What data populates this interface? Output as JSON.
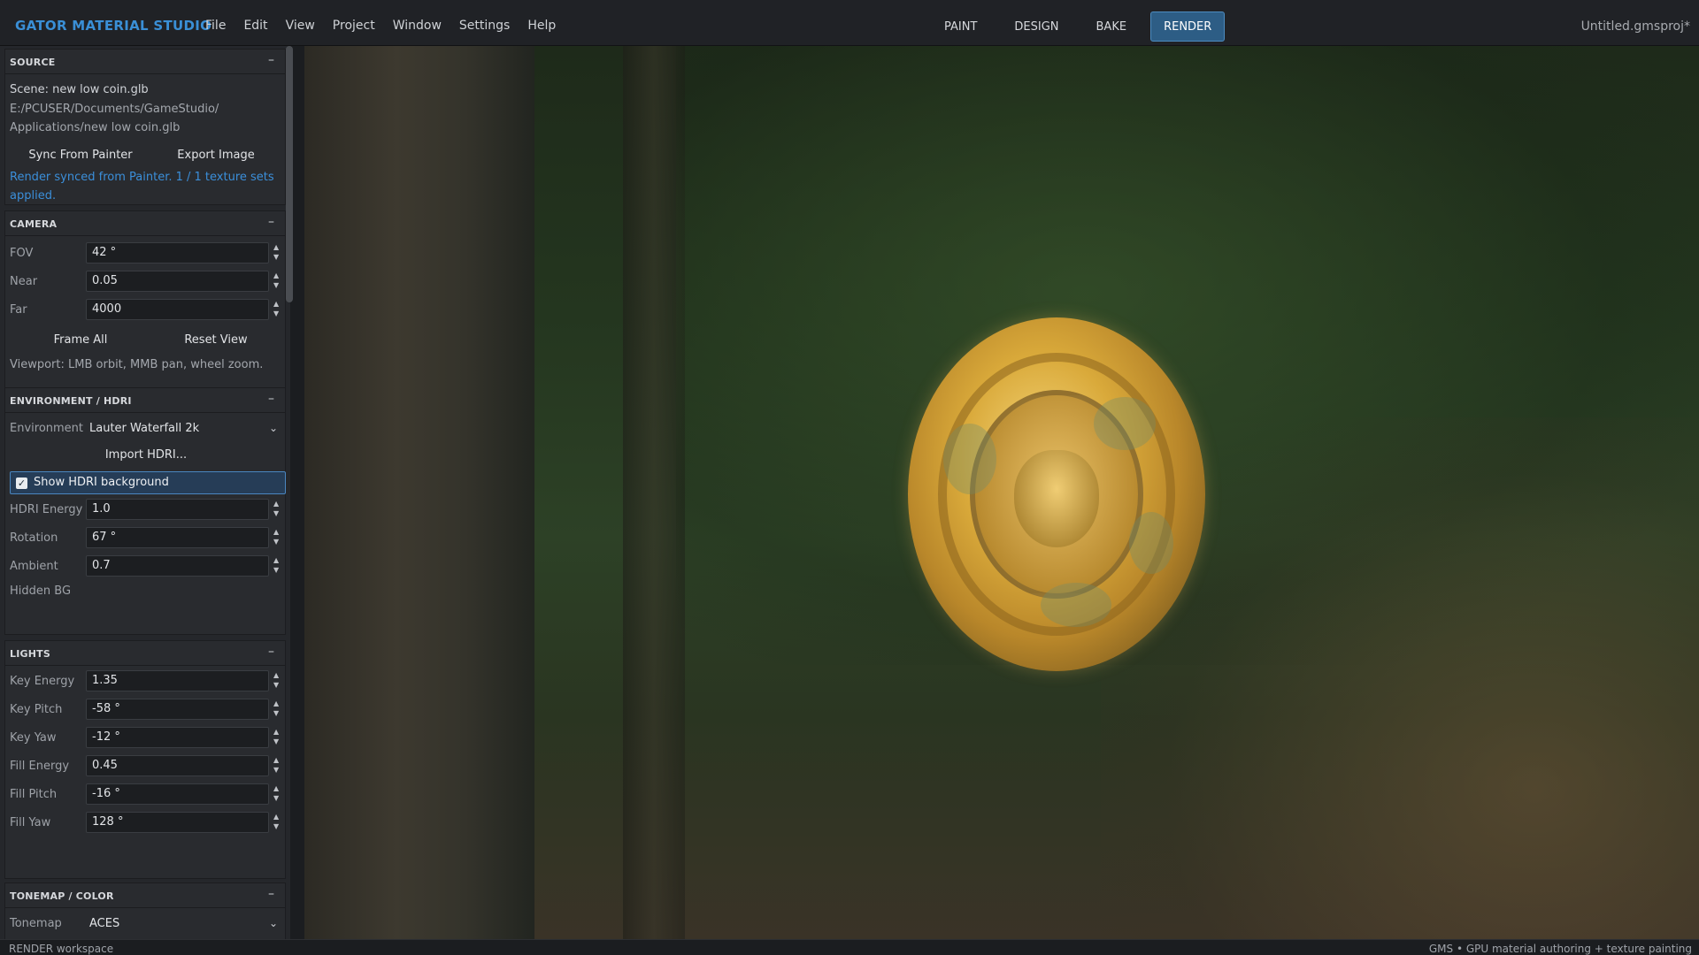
{
  "app": {
    "brand": "GATOR  MATERIAL STUDIO",
    "project": "Untitled.gmsproj*"
  },
  "menu": [
    "File",
    "Edit",
    "View",
    "Project",
    "Window",
    "Settings",
    "Help"
  ],
  "modes": [
    {
      "label": "PAINT",
      "active": false
    },
    {
      "label": "DESIGN",
      "active": false
    },
    {
      "label": "BAKE",
      "active": false
    },
    {
      "label": "RENDER",
      "active": true
    }
  ],
  "source": {
    "title": "SOURCE",
    "scene": "Scene: new low coin.glb",
    "path1": "E:/PCUSER/Documents/GameStudio/",
    "path2": "Applications/new low coin.glb",
    "sync_button": "Sync From Painter",
    "export_button": "Export Image",
    "status1": "Render synced from Painter. 1 / 1 texture sets",
    "status2": "applied."
  },
  "camera": {
    "title": "CAMERA",
    "fov_label": "FOV",
    "fov": "42 °",
    "near_label": "Near",
    "near": "0.05",
    "far_label": "Far",
    "far": "4000",
    "frame_all": "Frame All",
    "reset_view": "Reset View",
    "hint": "Viewport: LMB orbit, MMB pan, wheel zoom."
  },
  "environment": {
    "title": "ENVIRONMENT / HDRI",
    "env_label": "Environment",
    "env_value": "Lauter Waterfall 2k",
    "import_button": "Import HDRI...",
    "show_bg_label": "Show HDRI background",
    "show_bg_checked": true,
    "energy_label": "HDRI Energy",
    "energy": "1.0",
    "rotation_label": "Rotation",
    "rotation": "67 °",
    "ambient_label": "Ambient",
    "ambient": "0.7",
    "hidden_bg_label": "Hidden BG"
  },
  "lights": {
    "title": "LIGHTS",
    "key_energy_label": "Key Energy",
    "key_energy": "1.35",
    "key_pitch_label": "Key Pitch",
    "key_pitch": "-58 °",
    "key_yaw_label": "Key Yaw",
    "key_yaw": "-12 °",
    "fill_energy_label": "Fill Energy",
    "fill_energy": "0.45",
    "fill_pitch_label": "Fill Pitch",
    "fill_pitch": "-16 °",
    "fill_yaw_label": "Fill Yaw",
    "fill_yaw": "128 °"
  },
  "tonemap": {
    "title": "TONEMAP / COLOR",
    "tonemap_label": "Tonemap",
    "tonemap_value": "ACES"
  },
  "status": {
    "left": "RENDER workspace",
    "right": "GMS  •  GPU material authoring + texture painting"
  },
  "icons": {
    "collapse": "minus-icon",
    "spinner": "spin-arrows-icon",
    "dropdown": "chevron-down-icon",
    "check": "checkmark-icon"
  },
  "colors": {
    "accent": "#3a8fd6",
    "active_mode_bg": "#2d5d85",
    "checkbox_row_bg": "#263d57",
    "panel_bg": "#25272b"
  }
}
